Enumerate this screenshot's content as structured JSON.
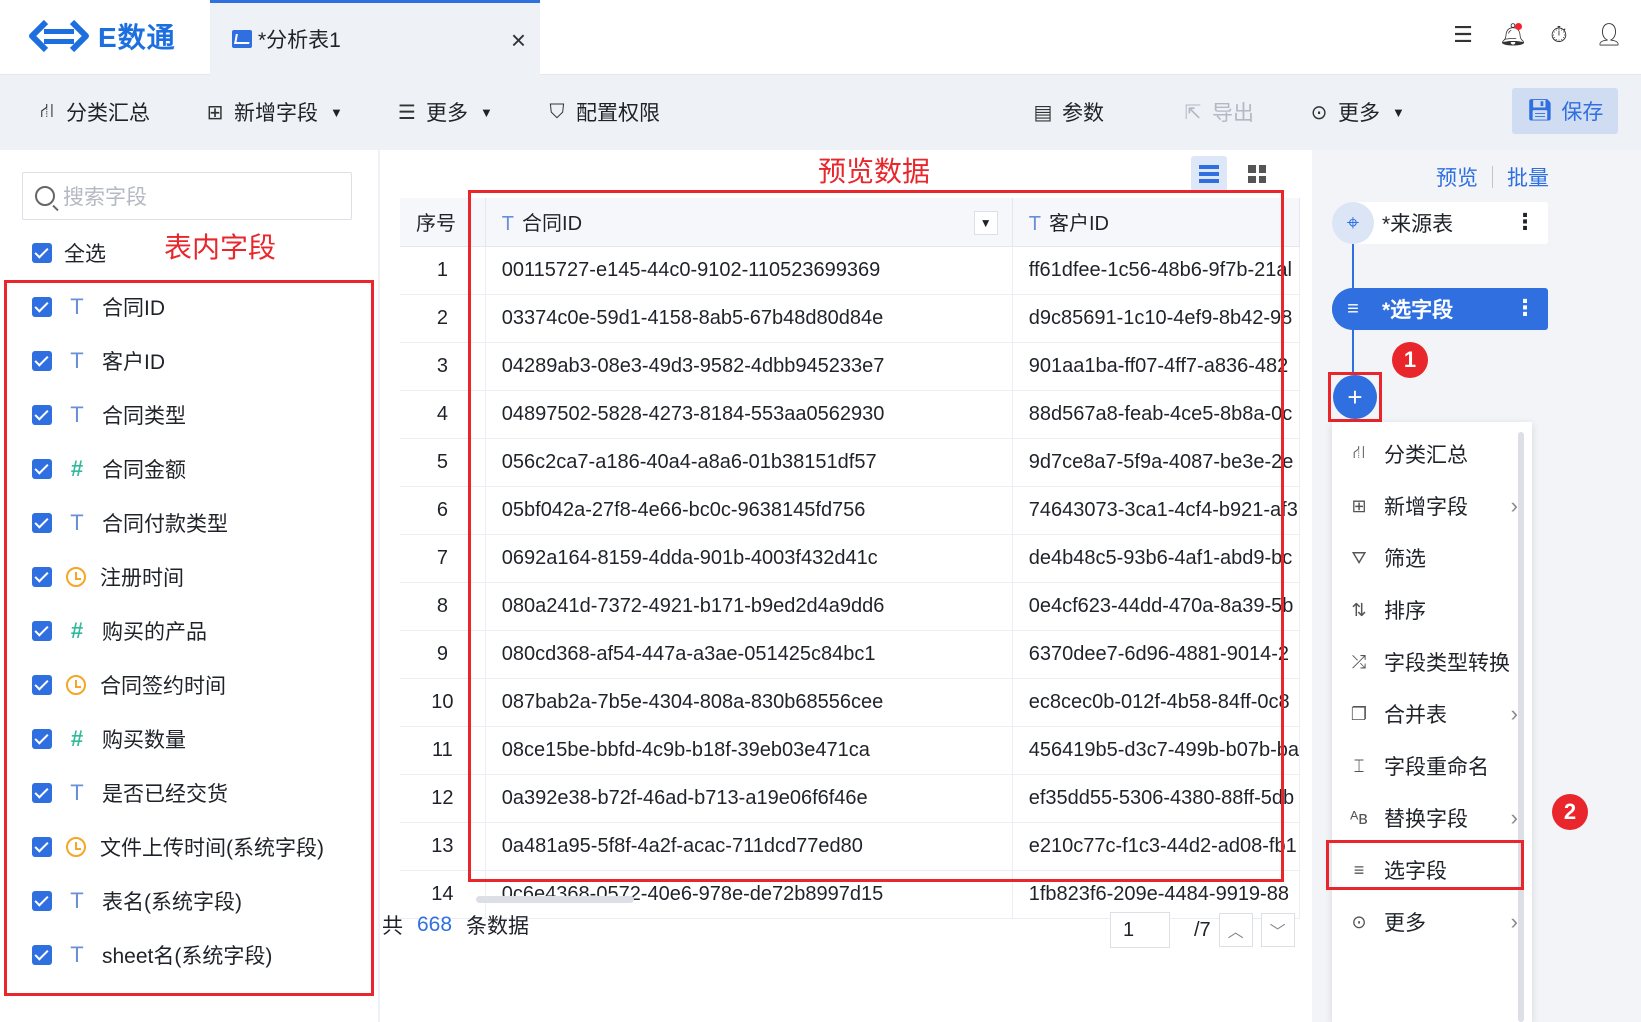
{
  "app": {
    "logo_text": "E数通"
  },
  "tab": {
    "label": "*分析表1",
    "close": "×"
  },
  "topbar_icons": [
    "list-icon",
    "bell-icon",
    "timer-icon",
    "user-icon"
  ],
  "toolbar": {
    "group": "分类汇总",
    "add_field": "新增字段",
    "more_left": "更多",
    "permissions": "配置权限",
    "params": "参数",
    "export": "导出",
    "more_right": "更多",
    "save": "保存"
  },
  "left": {
    "search_placeholder": "搜索字段",
    "select_all": "全选",
    "annotation": "表内字段",
    "fields": [
      {
        "type": "T",
        "name": "合同ID"
      },
      {
        "type": "T",
        "name": "客户ID"
      },
      {
        "type": "T",
        "name": "合同类型"
      },
      {
        "type": "#",
        "name": "合同金额"
      },
      {
        "type": "T",
        "name": "合同付款类型"
      },
      {
        "type": "date",
        "name": "注册时间"
      },
      {
        "type": "#",
        "name": "购买的产品"
      },
      {
        "type": "date",
        "name": "合同签约时间"
      },
      {
        "type": "#",
        "name": "购买数量"
      },
      {
        "type": "T",
        "name": "是否已经交货"
      },
      {
        "type": "date",
        "name": "文件上传时间(系统字段)"
      },
      {
        "type": "T",
        "name": "表名(系统字段)"
      },
      {
        "type": "T",
        "name": "sheet名(系统字段)"
      }
    ]
  },
  "center": {
    "annotation": "预览数据",
    "headers": {
      "index": "序号",
      "col_a": "合同ID",
      "col_b": "客户ID",
      "type_glyph": "T"
    },
    "rows": [
      {
        "i": "1",
        "a": "00115727-e145-44c0-9102-110523699369",
        "b": "ff61dfee-1c56-48b6-9f7b-21al"
      },
      {
        "i": "2",
        "a": "03374c0e-59d1-4158-8ab5-67b48d80d84e",
        "b": "d9c85691-1c10-4ef9-8b42-98"
      },
      {
        "i": "3",
        "a": "04289ab3-08e3-49d3-9582-4dbb945233e7",
        "b": "901aa1ba-ff07-4ff7-a836-482"
      },
      {
        "i": "4",
        "a": "04897502-5828-4273-8184-553aa0562930",
        "b": "88d567a8-feab-4ce5-8b8a-0c"
      },
      {
        "i": "5",
        "a": "056c2ca7-a186-40a4-a8a6-01b38151df57",
        "b": "9d7ce8a7-5f9a-4087-be3e-2e"
      },
      {
        "i": "6",
        "a": "05bf042a-27f8-4e66-bc0c-9638145fd756",
        "b": "74643073-3ca1-4cf4-b921-af3"
      },
      {
        "i": "7",
        "a": "0692a164-8159-4dda-901b-4003f432d41c",
        "b": "de4b48c5-93b6-4af1-abd9-bc"
      },
      {
        "i": "8",
        "a": "080a241d-7372-4921-b171-b9ed2d4a9dd6",
        "b": "0e4cf623-44dd-470a-8a39-5b"
      },
      {
        "i": "9",
        "a": "080cd368-af54-447a-a3ae-051425c84bc1",
        "b": "6370dee7-6d96-4881-9014-2"
      },
      {
        "i": "10",
        "a": "087bab2a-7b5e-4304-808a-830b68556cee",
        "b": "ec8cec0b-012f-4b58-84ff-0c8"
      },
      {
        "i": "11",
        "a": "08ce15be-bbfd-4c9b-b18f-39eb03e471ca",
        "b": "456419b5-d3c7-499b-b07b-ba"
      },
      {
        "i": "12",
        "a": "0a392e38-b72f-46ad-b713-a19e06f6f46e",
        "b": "ef35dd55-5306-4380-88ff-5db"
      },
      {
        "i": "13",
        "a": "0a481a95-5f8f-4a2f-acac-711dcd77ed80",
        "b": "e210c77c-f1c3-44d2-ad08-fb1"
      },
      {
        "i": "14",
        "a": "0c6e4368-0572-40e6-978e-de72b8997d15",
        "b": "1fb823f6-209e-4484-9919-88"
      }
    ],
    "footer": {
      "prefix": "共",
      "count": "668",
      "suffix": "条数据",
      "page": "1",
      "total_pages": "/7"
    }
  },
  "right": {
    "preview": "预览",
    "batch": "批量",
    "node_source": "*来源表",
    "node_select": "*选字段",
    "badge1": "1",
    "badge2": "2",
    "menu": [
      {
        "label": "分类汇总",
        "arrow": false,
        "icon": "group-icon"
      },
      {
        "label": "新增字段",
        "arrow": true,
        "icon": "add-field-icon"
      },
      {
        "label": "筛选",
        "arrow": false,
        "icon": "filter-icon"
      },
      {
        "label": "排序",
        "arrow": false,
        "icon": "sort-icon"
      },
      {
        "label": "字段类型转换",
        "arrow": false,
        "icon": "shuffle-icon"
      },
      {
        "label": "合并表",
        "arrow": true,
        "icon": "merge-icon"
      },
      {
        "label": "字段重命名",
        "arrow": false,
        "icon": "rename-icon"
      },
      {
        "label": "替换字段",
        "arrow": true,
        "icon": "replace-icon"
      },
      {
        "label": "选字段",
        "arrow": false,
        "icon": "select-field-icon"
      },
      {
        "label": "更多",
        "arrow": true,
        "icon": "more-icon"
      }
    ]
  },
  "colors": {
    "accent": "#2f6fe0",
    "annotation": "#e8262b",
    "number_type": "#33b99b",
    "date_type": "#f5a623"
  }
}
